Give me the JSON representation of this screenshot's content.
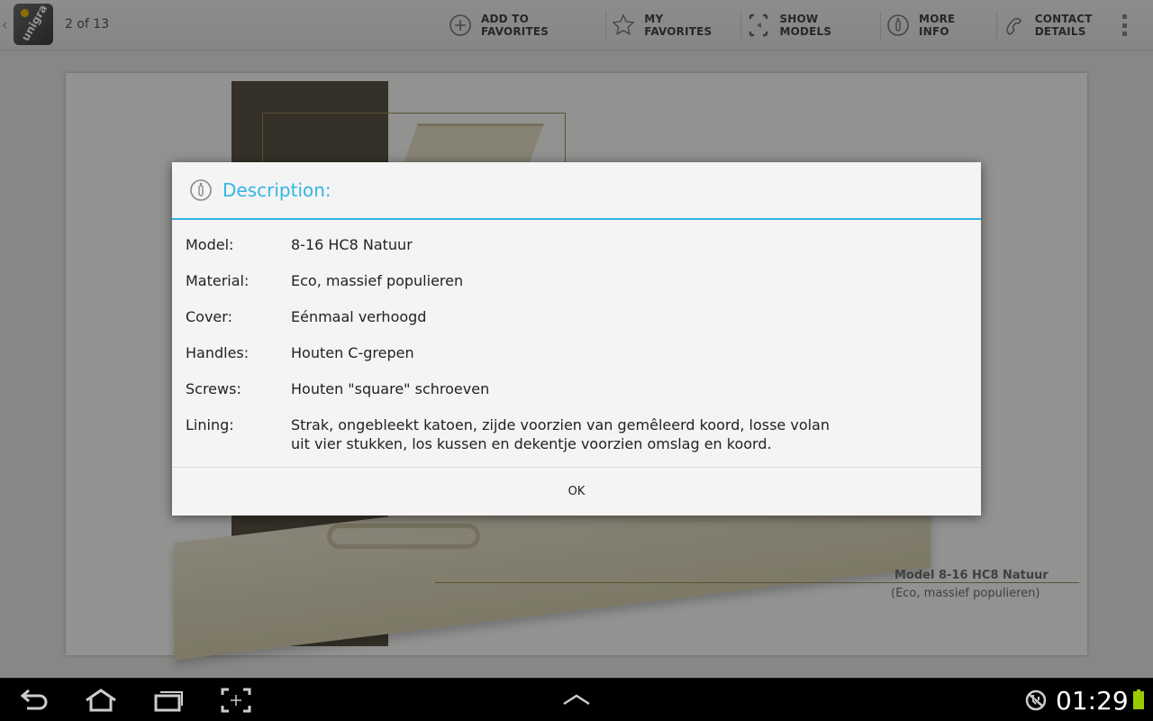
{
  "actionbar": {
    "page_counter": "2 of 13",
    "actions": [
      {
        "label": "ADD TO FAVORITES",
        "icon": "plus-circle-icon"
      },
      {
        "label": "MY FAVORITES",
        "icon": "star-icon"
      },
      {
        "label": "SHOW MODELS",
        "icon": "frame-icon"
      },
      {
        "label": "MORE INFO",
        "icon": "info-icon"
      },
      {
        "label": "CONTACT DETAILS",
        "icon": "phone-icon"
      }
    ],
    "logo_text": "unigra"
  },
  "page": {
    "caption_model": "Model 8-16 HC8 Natuur",
    "caption_material": "(Eco, massief populieren)"
  },
  "dialog": {
    "title": "Description:",
    "rows": [
      {
        "key": "Model:",
        "value": "8-16 HC8 Natuur"
      },
      {
        "key": "Material:",
        "value": "Eco, massief populieren"
      },
      {
        "key": "Cover:",
        "value": "Eénmaal verhoogd"
      },
      {
        "key": "Handles:",
        "value": "Houten C-grepen"
      },
      {
        "key": "Screws:",
        "value": "Houten \"square\" schroeven"
      },
      {
        "key": "Lining:",
        "value": "Strak, ongebleekt katoen, zijde voorzien van gemêleerd  koord, losse volan uit vier stukken, los kussen en dekentje voorzien omslag en koord."
      }
    ],
    "ok_label": "OK"
  },
  "navbar": {
    "clock": "01:29"
  },
  "colors": {
    "accent": "#33b5e5",
    "battery": "#99cc00"
  }
}
